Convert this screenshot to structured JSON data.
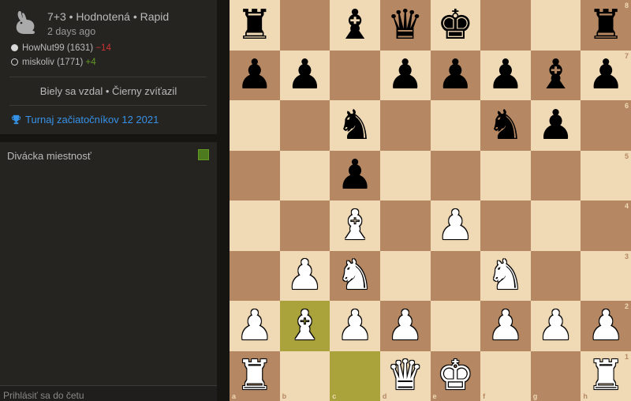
{
  "game": {
    "speed_icon": "rabbit-icon",
    "setup": "7+3 • Hodnotená • Rapid",
    "time_ago": "2 days ago",
    "white_player": {
      "name": "HowNut99 (1631)",
      "diff": "−14"
    },
    "black_player": {
      "name": "miskoliv (1771)",
      "diff": "+4"
    },
    "result": "Biely sa vzdal • Čierny zvíťazil",
    "tournament": "Turnaj začiatočníkov 12 2021"
  },
  "chat": {
    "title": "Divácka miestnosť",
    "placeholder": "Prihlásiť sa do četu"
  },
  "colors": {
    "light_square": "#f0d9b5",
    "dark_square": "#b58863",
    "highlight_light": "#cdd26a",
    "highlight_dark": "#aaa23a",
    "link": "#3692e7"
  },
  "board": {
    "files": [
      "a",
      "b",
      "c",
      "d",
      "e",
      "f",
      "g",
      "h"
    ],
    "ranks": [
      "8",
      "7",
      "6",
      "5",
      "4",
      "3",
      "2",
      "1"
    ],
    "position": [
      [
        "r",
        "",
        "",
        "b",
        "q",
        "k",
        "",
        "",
        "r"
      ],
      [
        "p",
        "p",
        "",
        "p",
        "p",
        "p",
        "b",
        "p"
      ],
      [
        "",
        "",
        "n",
        "",
        "",
        "n",
        "p",
        ""
      ],
      [
        "",
        "",
        "p",
        "",
        "",
        "",
        "",
        ""
      ],
      [
        "",
        "",
        "B",
        "",
        "P",
        "",
        "",
        ""
      ],
      [
        "",
        "P",
        "N",
        "",
        "",
        "N",
        "",
        ""
      ],
      [
        "P",
        "B",
        "P",
        "P",
        "",
        "P",
        "P",
        "P"
      ],
      [
        "R",
        "",
        "",
        "Q",
        "K",
        "",
        "",
        "R"
      ]
    ],
    "last_move": [
      "b2",
      "c1"
    ]
  }
}
